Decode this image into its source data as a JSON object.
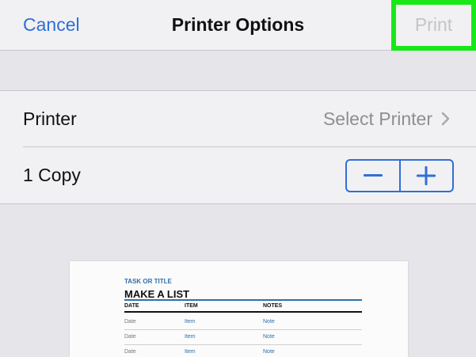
{
  "navbar": {
    "cancel_label": "Cancel",
    "title": "Printer Options",
    "print_label": "Print"
  },
  "options": {
    "printer_label": "Printer",
    "printer_value": "Select Printer",
    "copies_label": "1 Copy"
  },
  "preview": {
    "task_label": "TASK OR TITLE",
    "title": "MAKE A LIST",
    "columns": [
      "DATE",
      "ITEM",
      "NOTES"
    ],
    "rows": [
      [
        "Date",
        "Item",
        "Note"
      ],
      [
        "Date",
        "Item",
        "Note"
      ],
      [
        "Date",
        "Item",
        "Note"
      ]
    ]
  },
  "colors": {
    "accent": "#2f6fd6",
    "highlight": "#18e818",
    "disabled": "#c4c4c9"
  },
  "icons": {
    "chevron": "chevron-right-icon",
    "minus": "minus-icon",
    "plus": "plus-icon"
  }
}
